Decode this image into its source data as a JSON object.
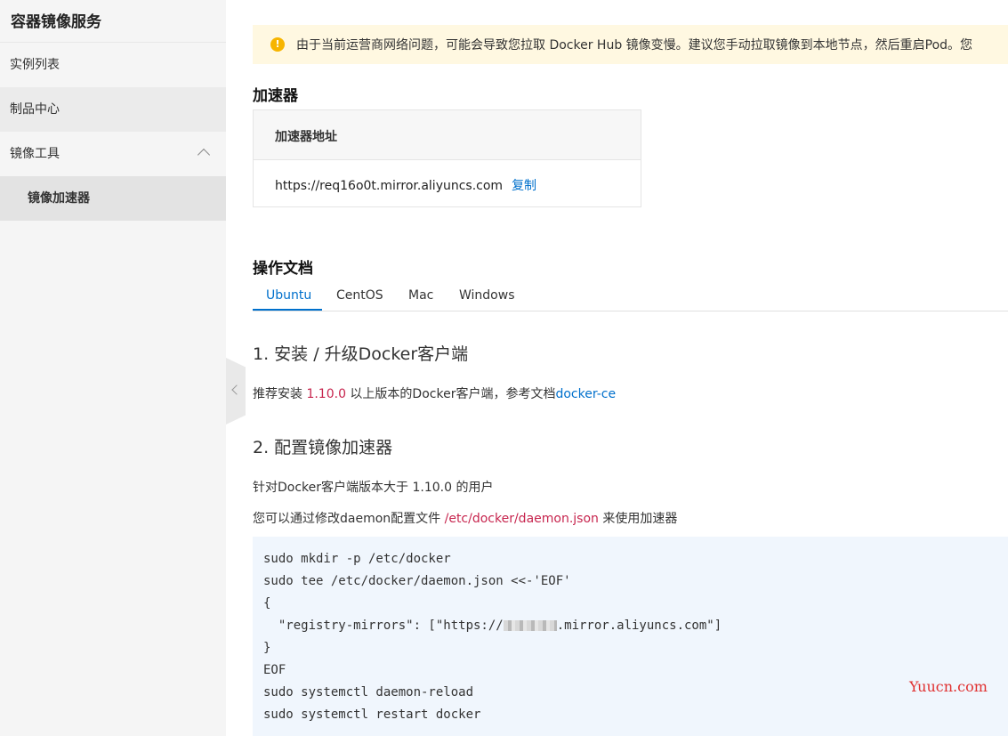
{
  "sidebar": {
    "title": "容器镜像服务",
    "items": [
      {
        "label": "实例列表"
      },
      {
        "label": "制品中心"
      },
      {
        "label": "镜像工具"
      },
      {
        "label": "镜像加速器"
      }
    ]
  },
  "notice": {
    "icon": "warning-icon",
    "text": "由于当前运营商网络问题，可能会导致您拉取 Docker Hub 镜像变慢。建议您手动拉取镜像到本地节点，然后重启Pod。您"
  },
  "accelerator": {
    "heading": "加速器",
    "card_header": "加速器地址",
    "address": "https://req16o0t.mirror.aliyuncs.com",
    "copy_label": "复制"
  },
  "docs": {
    "heading": "操作文档",
    "tabs": [
      {
        "label": "Ubuntu",
        "active": true
      },
      {
        "label": "CentOS",
        "active": false
      },
      {
        "label": "Mac",
        "active": false
      },
      {
        "label": "Windows",
        "active": false
      }
    ],
    "section1": {
      "title": "1. 安装 / 升级Docker客户端",
      "text_before": "推荐安装 ",
      "version": "1.10.0",
      "text_after": " 以上版本的Docker客户端，参考文档",
      "link": "docker-ce"
    },
    "section2": {
      "title": "2. 配置镜像加速器",
      "line1": "针对Docker客户端版本大于 1.10.0 的用户",
      "line2_before": "您可以通过修改daemon配置文件 ",
      "line2_path": "/etc/docker/daemon.json",
      "line2_after": " 来使用加速器"
    },
    "code": {
      "l1": "sudo mkdir -p /etc/docker",
      "l2": "sudo tee /etc/docker/daemon.json <<-'EOF'",
      "l3": "{",
      "l4_before": "  \"registry-mirrors\": [\"https://",
      "l4_after": ".mirror.aliyuncs.com\"]",
      "l5": "}",
      "l6": "EOF",
      "l7": "sudo systemctl daemon-reload",
      "l8": "sudo systemctl restart docker"
    }
  },
  "watermark": "Yuucn.com",
  "colors": {
    "accent": "#0070cc",
    "warning": "#f7b500",
    "code_red": "#c7254e"
  }
}
